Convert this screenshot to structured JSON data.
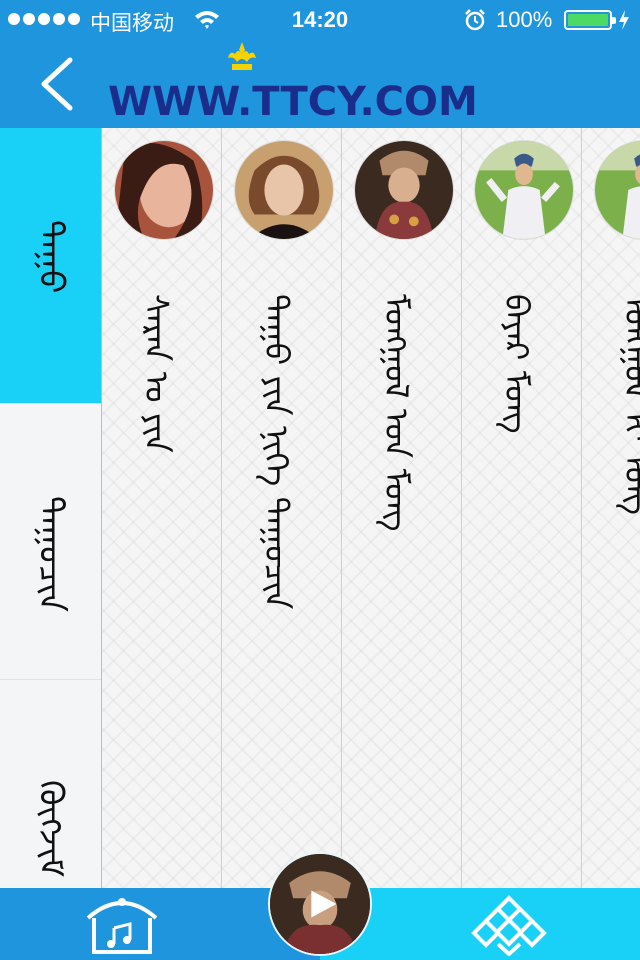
{
  "status_bar": {
    "carrier": "中国移动",
    "time": "14:20",
    "battery": "100%",
    "battery_level": 1.0
  },
  "header": {
    "back_icon": "chevron-left-icon",
    "logo_text": "WWW.TTCY.COM"
  },
  "sidebar": {
    "tabs": [
      {
        "label": "ᠳᠠᠭᠤ",
        "active": true
      },
      {
        "label": "ᠳᠠᠭᠤᠴᠢᠨ",
        "active": false
      },
      {
        "label": "ᠬᠥᠭᠵᠢᠮ",
        "active": false
      }
    ]
  },
  "artists": [
    {
      "name": "ᠰᠠᠷᠠᠨ ᠣ ᠶᠢᠨ",
      "avatar_colors": [
        "#a8543c",
        "#e8b49c",
        "#3a1c14"
      ]
    },
    {
      "name": "ᠳᠠᠭᠤ ᠶᠢᠨ ᠨᠢᠭᠡ ᠳᠠᠭᠤᠴᠢᠨ",
      "avatar_colors": [
        "#c8a070",
        "#7a4a2c",
        "#1a1210"
      ]
    },
    {
      "name": "ᠮᠣᠩᠭᠣᠯ ᠤᠨ ᠮᠣᠩ",
      "avatar_colors": [
        "#3a2a20",
        "#8a3a3a",
        "#c8a080"
      ]
    },
    {
      "name": "ᠪᠠᠶᠠᠷ ᠮᠣᠩ",
      "avatar_colors": [
        "#7cb04a",
        "#f0f0f4",
        "#6a9ac8"
      ]
    },
    {
      "name": "ᠮᠣᠩᠭᠣᠯ ᠢ ᠮᠣᠩ",
      "avatar_colors": [
        "#7cb04a",
        "#f0f0f4",
        "#6a9ac8"
      ]
    }
  ],
  "bottom_bar": {
    "home_icon": "yurt-music-icon",
    "play_icon": "play-icon",
    "knot_icon": "endless-knot-icon"
  },
  "colors": {
    "header_blue": "#1f95dd",
    "active_cyan": "#19d1f6",
    "logo_navy": "#1a2d8a",
    "battery_green": "#4cd964"
  }
}
